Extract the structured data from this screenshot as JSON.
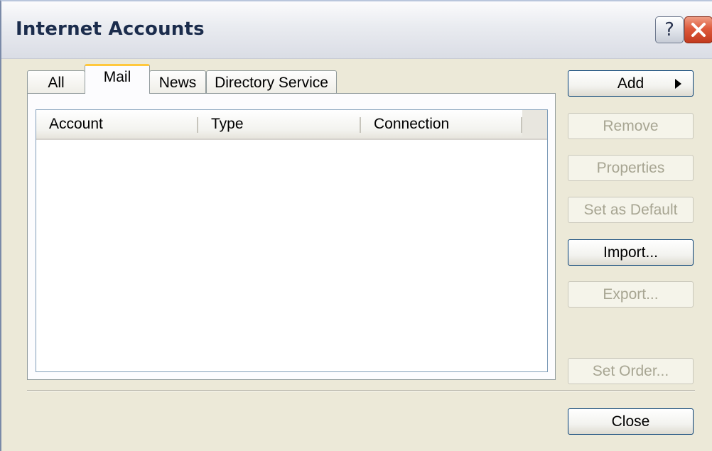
{
  "window": {
    "title": "Internet Accounts",
    "help_glyph": "?"
  },
  "tabs": [
    {
      "label": "All",
      "active": false
    },
    {
      "label": "Mail",
      "active": true
    },
    {
      "label": "News",
      "active": false
    },
    {
      "label": "Directory Service",
      "active": false
    }
  ],
  "list": {
    "columns": [
      "Account",
      "Type",
      "Connection"
    ],
    "rows": []
  },
  "buttons": {
    "add": {
      "label": "Add",
      "enabled": true
    },
    "remove": {
      "label": "Remove",
      "enabled": false
    },
    "properties": {
      "label": "Properties",
      "enabled": false
    },
    "set_default": {
      "label": "Set as Default",
      "enabled": false
    },
    "import": {
      "label": "Import...",
      "enabled": true
    },
    "export": {
      "label": "Export...",
      "enabled": false
    },
    "set_order": {
      "label": "Set Order...",
      "enabled": false
    },
    "close": {
      "label": "Close",
      "enabled": true
    }
  },
  "icons": {
    "help": "question-mark-icon",
    "close": "close-x-icon",
    "add_menu": "triangle-right-icon"
  },
  "colors": {
    "tab_highlight": "#ffc83c",
    "close_button": "#de5a3c",
    "button_border": "#003c74",
    "disabled_text": "#a7a592"
  }
}
